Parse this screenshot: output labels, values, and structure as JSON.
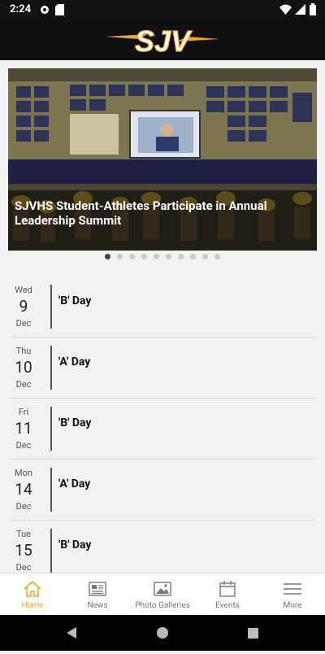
{
  "status_bar": {
    "time": "2:24"
  },
  "header": {
    "logo_text": "SJV"
  },
  "carousel": {
    "caption": "SJVHS Student-Athletes Participate in Annual Leadership Summit",
    "total_slides": 10,
    "active_index": 0
  },
  "events": [
    {
      "dow": "Wed",
      "day": "9",
      "mon": "Dec",
      "title": "'B' Day"
    },
    {
      "dow": "Thu",
      "day": "10",
      "mon": "Dec",
      "title": "'A' Day"
    },
    {
      "dow": "Fri",
      "day": "11",
      "mon": "Dec",
      "title": "'B' Day"
    },
    {
      "dow": "Mon",
      "day": "14",
      "mon": "Dec",
      "title": "'A' Day"
    },
    {
      "dow": "Tue",
      "day": "15",
      "mon": "Dec",
      "title": "'B' Day"
    }
  ],
  "tabs": [
    {
      "label": "Home",
      "icon": "home-icon",
      "active": true
    },
    {
      "label": "News",
      "icon": "news-icon",
      "active": false
    },
    {
      "label": "Photo Galleries",
      "icon": "photo-icon",
      "active": false
    },
    {
      "label": "Events",
      "icon": "calendar-icon",
      "active": false
    },
    {
      "label": "More",
      "icon": "menu-icon",
      "active": false
    }
  ],
  "colors": {
    "accent": "#f0a81f",
    "appbar": "#101010",
    "background": "#f2f2f2"
  }
}
